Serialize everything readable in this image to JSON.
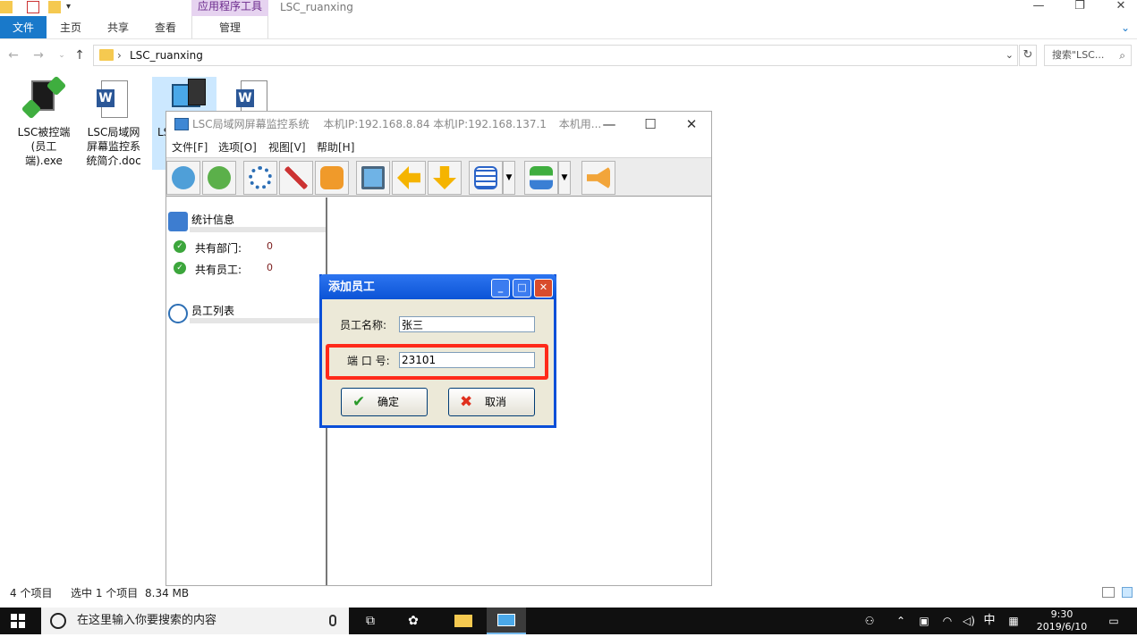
{
  "explorer": {
    "title": "LSC_ruanxing",
    "context_tab_group": "应用程序工具",
    "ribbon_tabs": [
      "文件",
      "主页",
      "共享",
      "查看",
      "管理"
    ],
    "address_path": "LSC_ruanxing",
    "search_placeholder": "搜索\"LSC...",
    "files": [
      {
        "name": "LSC被控端(员工端).exe",
        "icon": "monitor-exe-icon"
      },
      {
        "name": "LSC局域网屏幕监控系统简介.doc",
        "icon": "word-doc-icon"
      },
      {
        "name": "LS",
        "icon": "computer-app-icon"
      },
      {
        "name": "",
        "icon": "word-doc-icon"
      }
    ],
    "status_left": "4 个项目",
    "status_selection": "选中 1 个项目",
    "status_size": "8.34 MB"
  },
  "taskbar": {
    "search_placeholder": "在这里输入你要搜索的内容",
    "ime": "中",
    "time": "9:30",
    "date": "2019/6/10"
  },
  "app": {
    "title": "LSC局域网屏幕监控系统",
    "ip_info": "本机IP:192.168.8.84  本机IP:192.168.137.1",
    "title_extra": "本机用...",
    "menu": [
      "文件[F]",
      "选项[O]",
      "视图[V]",
      "帮助[H]"
    ],
    "stats_title": "统计信息",
    "stats": [
      {
        "label": "共有部门:",
        "value": "0"
      },
      {
        "label": "共有员工:",
        "value": "0"
      }
    ],
    "employee_list_title": "员工列表"
  },
  "dialog": {
    "title": "添加员工",
    "name_label": "员工名称:",
    "name_value": "张三",
    "port_label": "端 口 号:",
    "port_value": "23101",
    "ok_label": "确定",
    "cancel_label": "取消"
  },
  "colors": {
    "explorer_accent": "#1979ca",
    "dialog_title_blue": "#0b53d6",
    "highlight_red": "#ff2a1a"
  }
}
